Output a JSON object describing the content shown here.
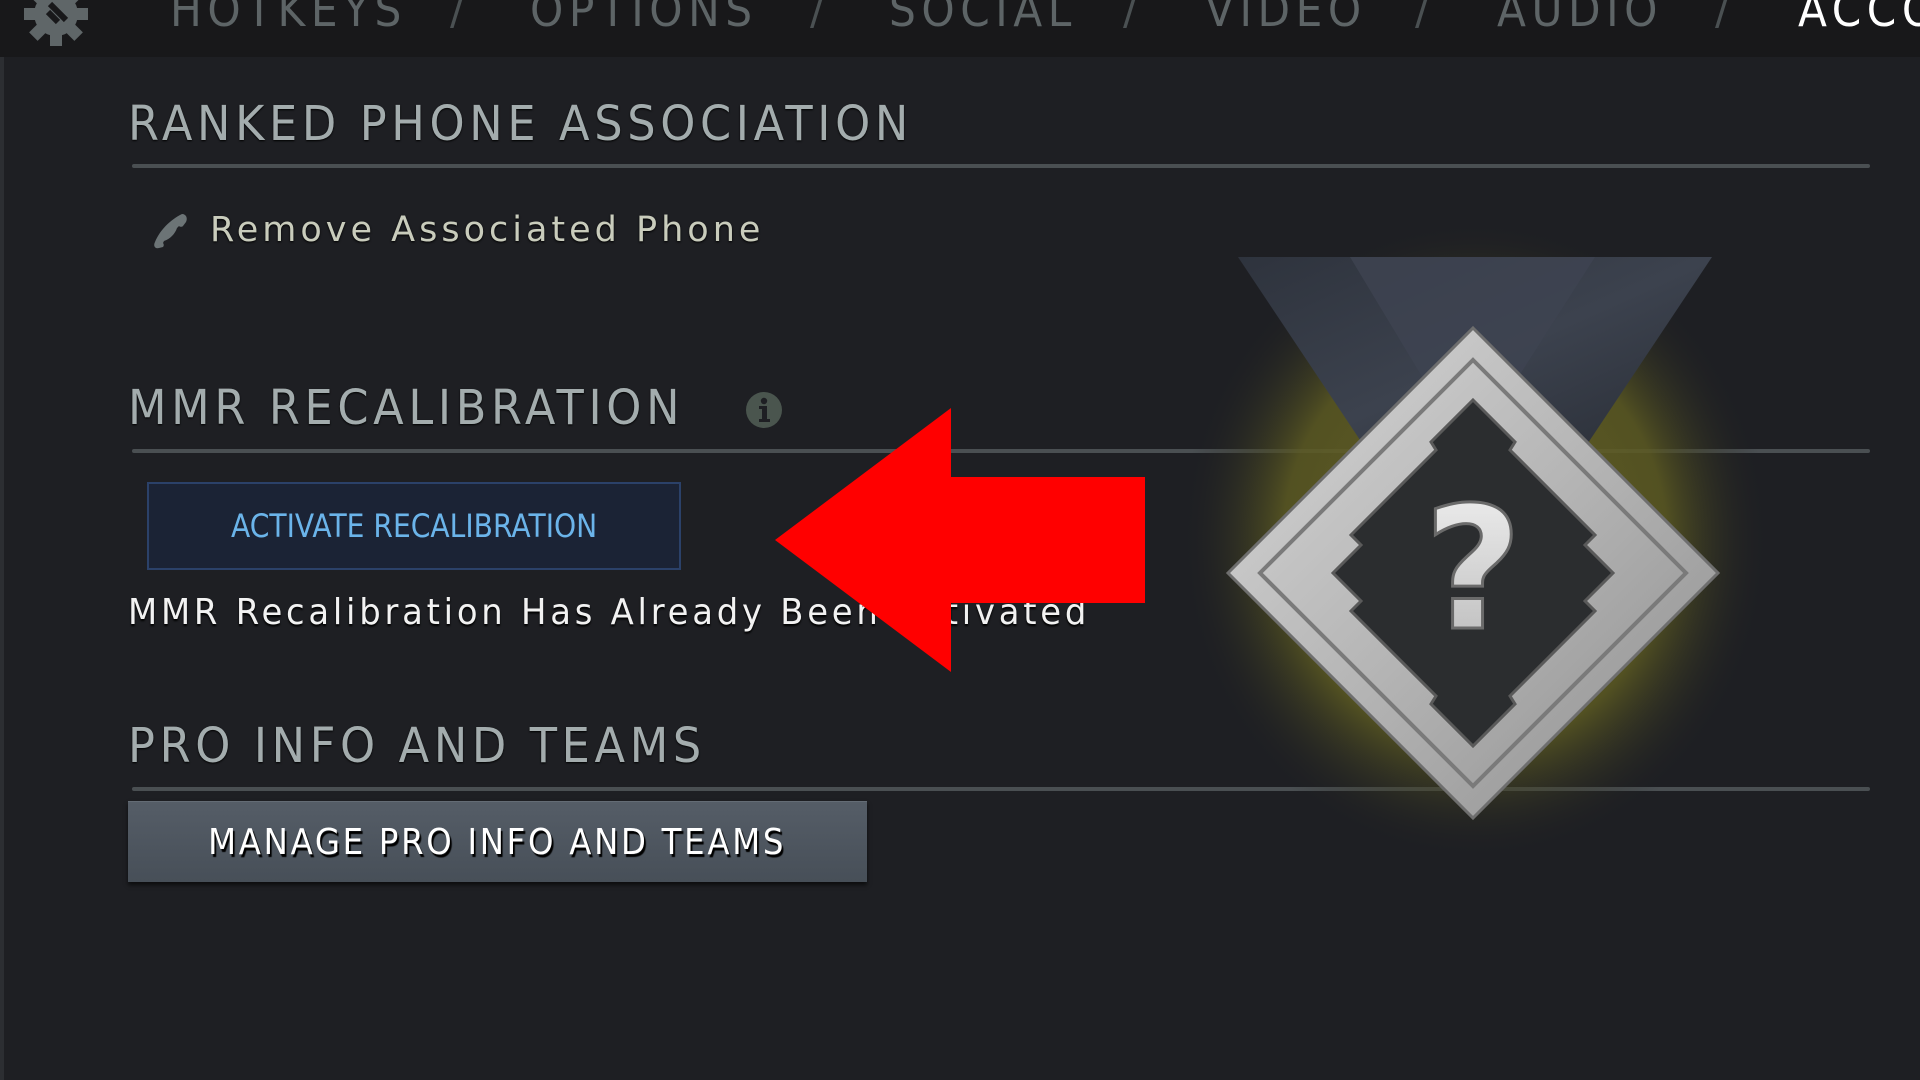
{
  "nav": {
    "items": [
      {
        "label": "HOTKEYS",
        "active": false
      },
      {
        "label": "OPTIONS",
        "active": false
      },
      {
        "label": "SOCIAL",
        "active": false
      },
      {
        "label": "VIDEO",
        "active": false
      },
      {
        "label": "AUDIO",
        "active": false
      },
      {
        "label": "ACCO",
        "active": true
      }
    ],
    "separator": "/",
    "gear_icon": "settings-gear-icon"
  },
  "sections": {
    "phone": {
      "title": "RANKED PHONE ASSOCIATION",
      "remove_label": "Remove Associated Phone",
      "icon": "phone-icon"
    },
    "recalibration": {
      "title": "MMR RECALIBRATION",
      "info_icon": "info-icon",
      "button_label": "ACTIVATE RECALIBRATION",
      "status": "MMR Recalibration Has Already Been Activated"
    },
    "pro": {
      "title": "PRO INFO AND TEAMS",
      "button_label": "MANAGE PRO INFO AND TEAMS"
    }
  },
  "medal": {
    "glyph": "?",
    "description": "uncalibrated rank medal"
  },
  "annotation": {
    "type": "arrow",
    "direction": "left",
    "color": "#ff0000"
  },
  "colors": {
    "background": "#1e1f23",
    "navbar": "#18181a",
    "accent_blue": "#6bb4ea",
    "medal_glow": "#5c5a22"
  }
}
